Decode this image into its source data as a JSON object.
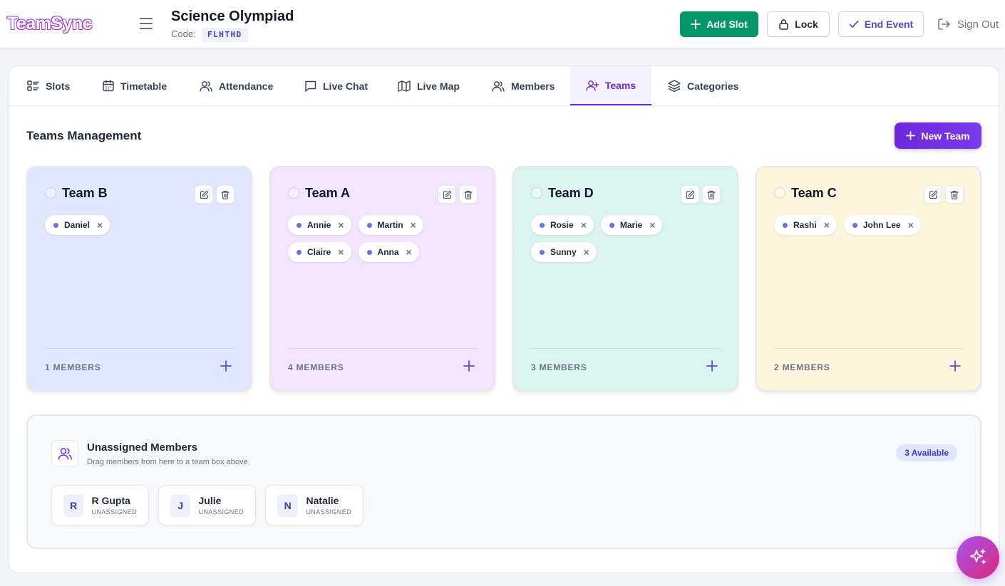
{
  "header": {
    "logo": "TeamSync",
    "event_title": "Science Olympiad",
    "code_label": "Code:",
    "code_value": "FLHTHD",
    "add_slot_label": "Add Slot",
    "lock_label": "Lock",
    "end_event_label": "End Event",
    "sign_out_label": "Sign Out"
  },
  "tabs": [
    {
      "label": "Slots",
      "icon": "list-icon"
    },
    {
      "label": "Timetable",
      "icon": "calendar-icon"
    },
    {
      "label": "Attendance",
      "icon": "users-icon"
    },
    {
      "label": "Live Chat",
      "icon": "chat-icon"
    },
    {
      "label": "Live Map",
      "icon": "map-icon"
    },
    {
      "label": "Members",
      "icon": "users-icon"
    },
    {
      "label": "Teams",
      "icon": "user-plus-icon",
      "active": true
    },
    {
      "label": "Categories",
      "icon": "layers-icon"
    }
  ],
  "teams_section": {
    "title": "Teams Management",
    "new_team_label": "New Team"
  },
  "teams": [
    {
      "name": "Team B",
      "members": [
        "Daniel"
      ],
      "count_label": "1 MEMBERS",
      "bg": "#e0e7ff"
    },
    {
      "name": "Team A",
      "members": [
        "Annie",
        "Martin",
        "Claire",
        "Anna"
      ],
      "count_label": "4 MEMBERS",
      "bg": "#f3e5fd"
    },
    {
      "name": "Team D",
      "members": [
        "Rosie",
        "Marie",
        "Sunny"
      ],
      "count_label": "3 MEMBERS",
      "bg": "#dcf4f0"
    },
    {
      "name": "Team C",
      "members": [
        "Rashi",
        "John Lee"
      ],
      "count_label": "2 MEMBERS",
      "bg": "#fef6dc"
    }
  ],
  "unassigned": {
    "title": "Unassigned Members",
    "subtitle": "Drag members from here to a team box above",
    "available_label": "3 Available",
    "members": [
      {
        "initial": "R",
        "name": "R Gupta",
        "status": "UNASSIGNED"
      },
      {
        "initial": "J",
        "name": "Julie",
        "status": "UNASSIGNED"
      },
      {
        "initial": "N",
        "name": "Natalie",
        "status": "UNASSIGNED"
      }
    ]
  },
  "colors": {
    "accent": "#6d28d9",
    "success": "#059669",
    "chip_dot": "#6d6fe6"
  }
}
